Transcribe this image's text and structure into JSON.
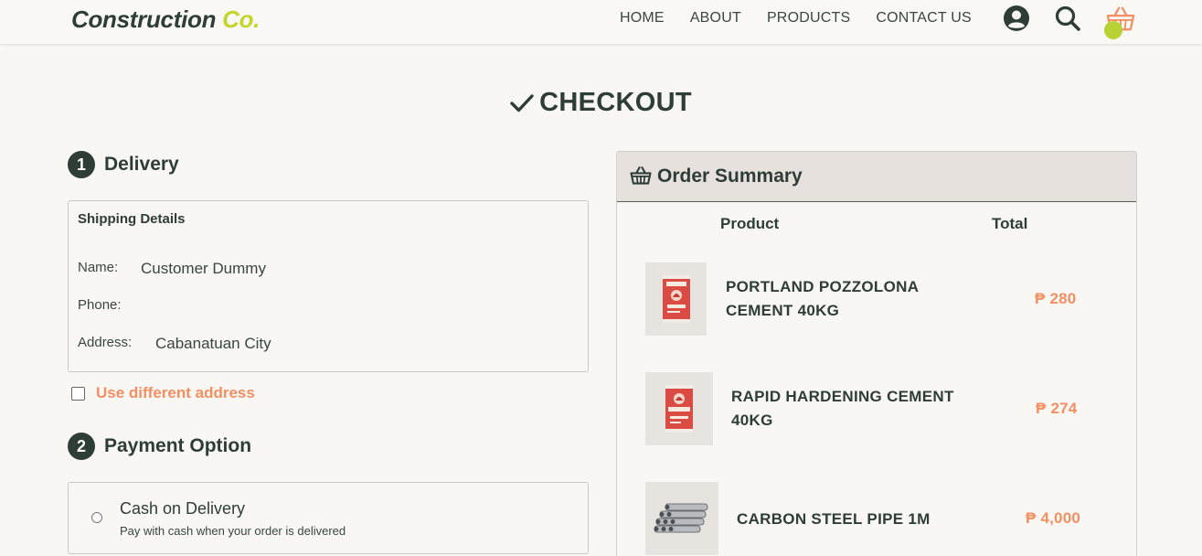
{
  "header": {
    "brand_main": "Construction",
    "brand_accent": "Co.",
    "nav": [
      "HOME",
      "ABOUT",
      "PRODUCTS",
      "CONTACT US"
    ],
    "icons": [
      "account-icon",
      "search-icon",
      "cart-icon"
    ],
    "accent_color": "#c3d42a"
  },
  "page": {
    "title": "CHECKOUT"
  },
  "delivery": {
    "step": "1",
    "title": "Delivery",
    "box_title": "Shipping Details",
    "name_label": "Name:",
    "name_value": "Customer Dummy",
    "phone_label": "Phone:",
    "phone_value": "",
    "address_label": "Address:",
    "address_value": "Cabanatuan City",
    "different_address_label": "Use different address",
    "different_address_checked": false
  },
  "payment": {
    "step": "2",
    "title": "Payment Option",
    "options": [
      {
        "title": "Cash on Delivery",
        "description": "Pay with cash when your order is delivered",
        "selected": false
      }
    ]
  },
  "summary": {
    "title": "Order Summary",
    "col_product": "Product",
    "col_total": "Total",
    "items": [
      {
        "name_line1": "PORTLAND POZZOLONA",
        "name_line2": "CEMENT 40KG",
        "price": "₱ 280",
        "image": "cement-bag"
      },
      {
        "name_line1": "RAPID HARDENING CEMENT",
        "name_line2": "40KG",
        "price": "₱ 274",
        "image": "cement-bag"
      },
      {
        "name_line1": "CARBON STEEL PIPE 1M",
        "name_line2": "",
        "price": "₱ 4,000",
        "image": "steel-pipes"
      }
    ]
  },
  "colors": {
    "primary": "#2e3d36",
    "price": "#f28f63",
    "background": "#f8f7f4"
  }
}
